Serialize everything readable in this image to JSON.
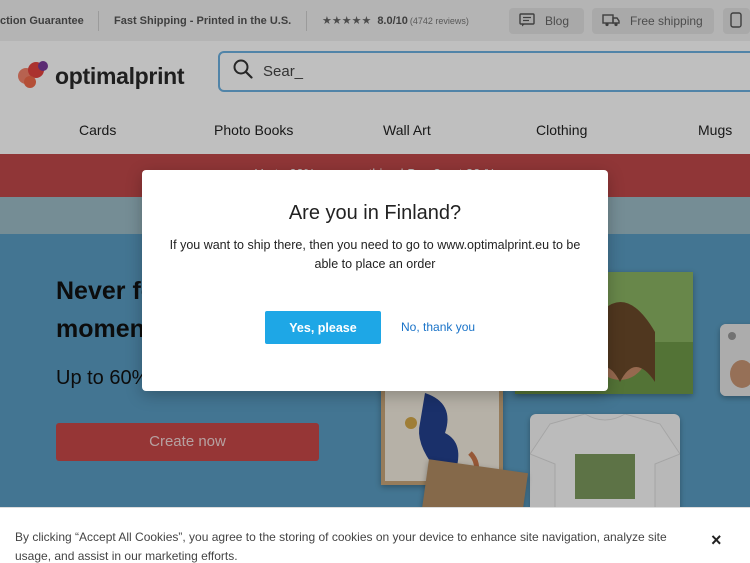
{
  "top_strip": {
    "guarantee": "ction Guarantee",
    "shipping_note": "Fast Shipping - Printed in the U.S.",
    "stars": "★★★★★",
    "rating": "8.0/10",
    "reviews": "(4742 reviews)",
    "blog_label": "Blog",
    "free_shipping_label": "Free shipping"
  },
  "header": {
    "logo_text": "optimalprint",
    "search_value": "Sear_"
  },
  "nav": {
    "items": [
      "Cards",
      "Photo Books",
      "Wall Art",
      "Clothing",
      "Mugs"
    ]
  },
  "promo": {
    "text": "Up to 60% on everything | Buy 2 get 30 %"
  },
  "hero": {
    "title": "Never forget the special moments",
    "subtitle": "Up to 60% off",
    "cta": "Create now"
  },
  "modal": {
    "title": "Are you in Finland?",
    "body": "If you want to ship there, then you need to go to www.optimalprint.eu to be able to place an order",
    "yes_label": "Yes, please",
    "no_label": "No, thank you"
  },
  "cookie": {
    "text": "By clicking “Accept All Cookies”, you agree to the storing of cookies on your device to enhance site navigation, analyze site usage, and assist in our marketing efforts.",
    "close_label": "×"
  },
  "colors": {
    "brand_red": "#e5433f",
    "promo_red": "#c1494a",
    "hero_blue": "#5a9dc3",
    "button_blue": "#1ea7e6",
    "link_blue": "#1a73c8"
  },
  "icons": [
    "star-icon",
    "blog-icon",
    "truck-icon",
    "phone-icon",
    "search-icon",
    "logo-dots-icon",
    "close-icon"
  ]
}
